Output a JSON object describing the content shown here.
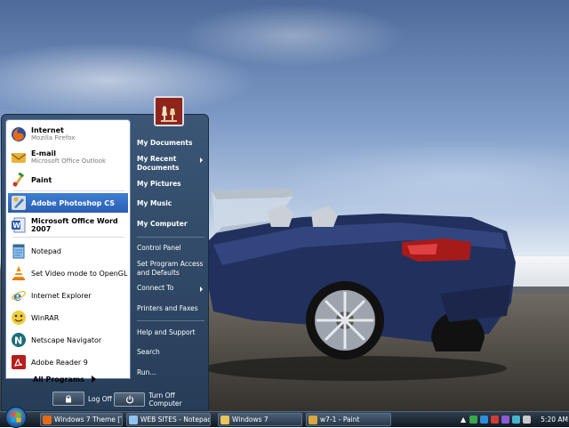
{
  "start_menu": {
    "pinned": [
      {
        "title": "Internet",
        "subtitle": "Mozilla Firefox",
        "icon": "firefox-icon"
      },
      {
        "title": "E-mail",
        "subtitle": "Microsoft Office Outlook",
        "icon": "outlook-icon"
      }
    ],
    "recent": [
      {
        "title": "Paint",
        "icon": "paint-icon"
      },
      {
        "title": "Adobe Photoshop CS",
        "icon": "photoshop-icon",
        "selected": true
      },
      {
        "title": "Microsoft Office Word 2007",
        "icon": "word-icon"
      },
      {
        "title": "Notepad",
        "icon": "notepad-icon"
      },
      {
        "title": "Set Video mode to OpenGL",
        "icon": "vlc-icon"
      },
      {
        "title": "Internet Explorer",
        "icon": "ie-icon"
      },
      {
        "title": "WinRAR",
        "icon": "winrar-icon"
      },
      {
        "title": "Netscape Navigator",
        "icon": "netscape-icon"
      },
      {
        "title": "Adobe Reader 9",
        "icon": "adobe-reader-icon"
      }
    ],
    "all_programs": "All Programs",
    "right_items": [
      {
        "label": "My Documents"
      },
      {
        "label": "My Recent Documents",
        "submenu": true
      },
      {
        "label": "My Pictures"
      },
      {
        "label": "My Music"
      },
      {
        "label": "My Computer"
      },
      {
        "label": "Control Panel"
      },
      {
        "label": "Set Program Access and Defaults"
      },
      {
        "label": "Connect To",
        "submenu": true
      },
      {
        "label": "Printers and Faxes"
      },
      {
        "label": "Help and Support"
      },
      {
        "label": "Search"
      },
      {
        "label": "Run..."
      }
    ],
    "log_off": "Log Off",
    "turn_off": "Turn Off Computer"
  },
  "taskbar": {
    "buttons": [
      {
        "label": "Windows 7 Theme [T...",
        "icon": "firefox-icon"
      },
      {
        "label": "WEB SITES - Notepad",
        "icon": "notepad-icon"
      },
      {
        "label": "Windows 7",
        "icon": "folder-icon"
      },
      {
        "label": "w7-1 - Paint",
        "icon": "paint-icon"
      }
    ],
    "clock": "5:20 AM"
  },
  "colors": {
    "menu_bg": "#2d4564",
    "selection": "#2f6cc2",
    "taskbar": "#1d2834",
    "car_blue": "#22305e"
  }
}
